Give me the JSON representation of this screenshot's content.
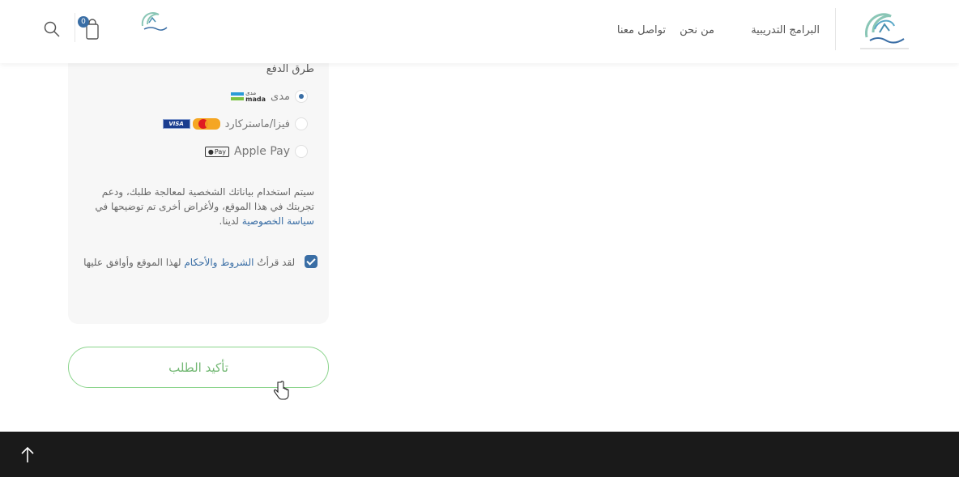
{
  "header": {
    "nav": {
      "programs": "البرامج التدريبية",
      "about": "من نحن",
      "contact": "تواصل معنا"
    },
    "cart_count": "0",
    "icons": [
      "logo",
      "search-icon",
      "cart-icon"
    ]
  },
  "payment": {
    "title": "طرق الدفع",
    "methods": [
      {
        "label": "مدى",
        "selected": true,
        "badge": "mada"
      },
      {
        "label": "فيزا/ماستركارد",
        "selected": false,
        "badge": "visa-mastercard"
      },
      {
        "label": "Apple Pay",
        "selected": false,
        "badge": "apple-pay"
      }
    ],
    "mada_badge_text": "mada",
    "mada_badge_ar": "مدى",
    "visa_text": "VISA",
    "applepay_badge_text": "Pay",
    "privacy_text": "سيتم استخدام بياناتك الشخصية لمعالجة طلبك، ودعم تجربتك في هذا الموقع، ولأغراض أخرى تم توضيحها في",
    "privacy_link": "سياسة الخصوصية",
    "privacy_suffix": "لدينا.",
    "terms_prefix": "لقد قرأتُ",
    "terms_link": "الشروط والأحكام",
    "terms_suffix": "لهذا الموقع وأوافق عليها",
    "terms_checked": true
  },
  "confirm_button": "تأكيد الطلب",
  "colors": {
    "accent": "#3a6ea5",
    "button_border": "#8bd48c",
    "button_text": "#73b874",
    "footer": "#1a1a1a"
  }
}
